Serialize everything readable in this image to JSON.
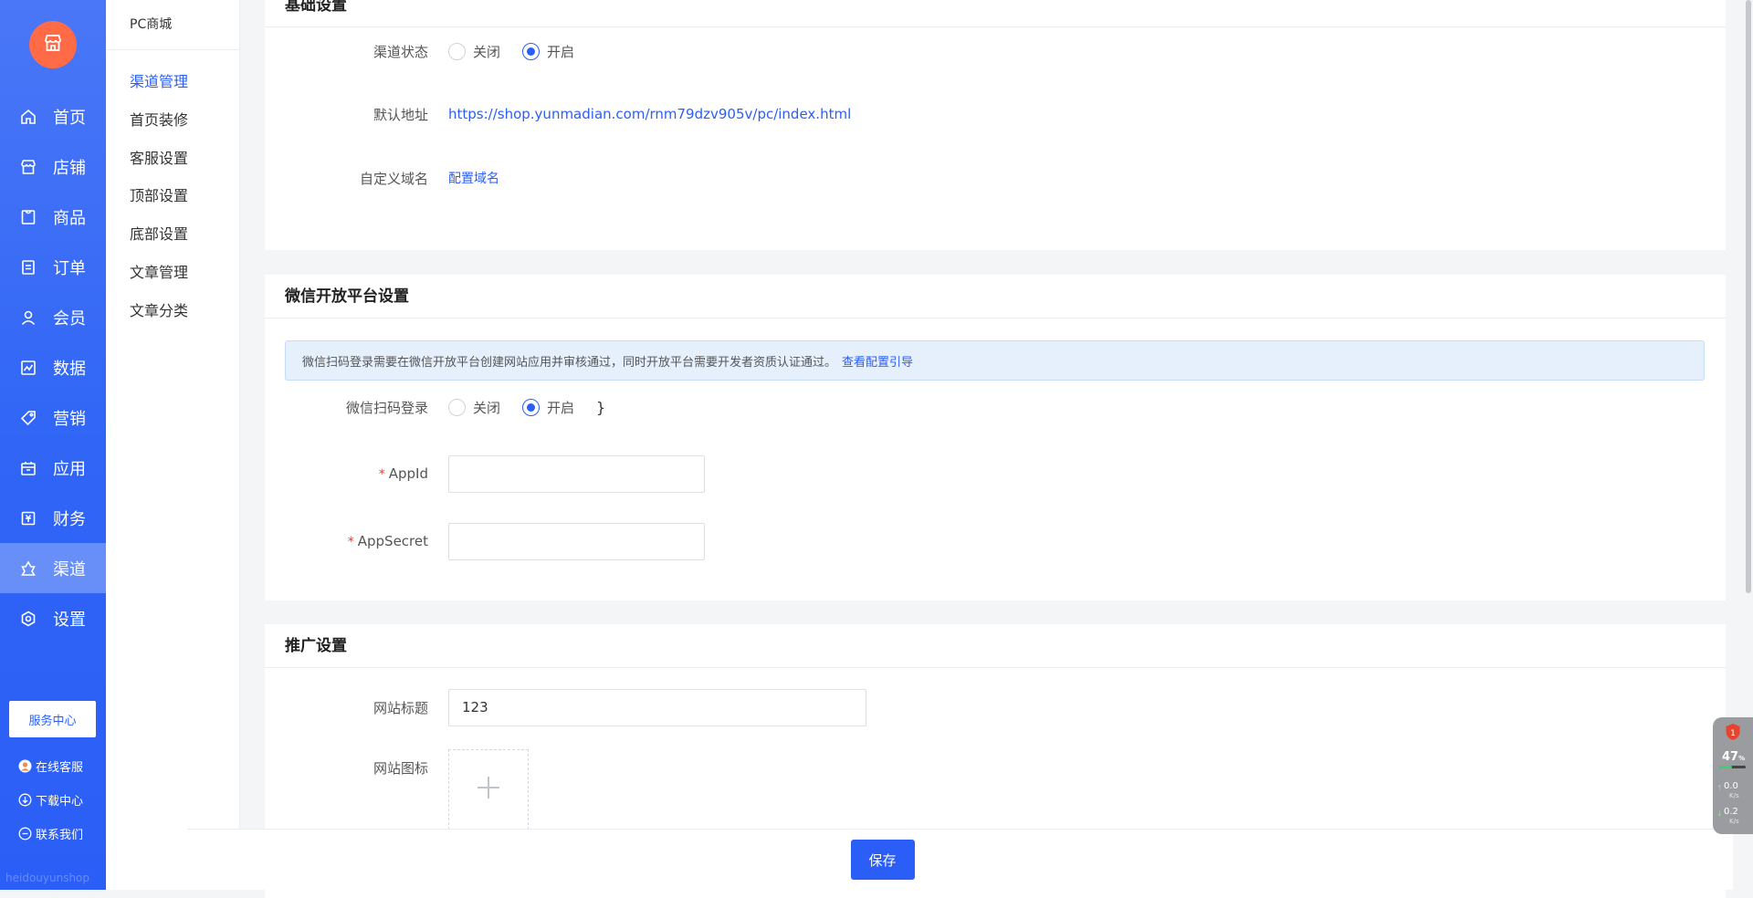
{
  "sidebar": {
    "logo_icon": "shop-icon",
    "items": [
      {
        "label": "首页",
        "icon": "home-icon"
      },
      {
        "label": "店铺",
        "icon": "store-icon"
      },
      {
        "label": "商品",
        "icon": "goods-icon"
      },
      {
        "label": "订单",
        "icon": "order-icon"
      },
      {
        "label": "会员",
        "icon": "member-icon"
      },
      {
        "label": "数据",
        "icon": "chart-icon"
      },
      {
        "label": "营销",
        "icon": "tag-icon"
      },
      {
        "label": "应用",
        "icon": "app-box-icon"
      },
      {
        "label": "财务",
        "icon": "finance-icon"
      },
      {
        "label": "渠道",
        "icon": "channel-icon",
        "active": true
      },
      {
        "label": "设置",
        "icon": "gear-icon"
      }
    ],
    "service_center": "服务中心",
    "links": [
      {
        "label": "在线客服",
        "icon": "avatar-icon"
      },
      {
        "label": "下载中心",
        "icon": "download-icon"
      },
      {
        "label": "联系我们",
        "icon": "chat-icon"
      }
    ],
    "watermark": "heidouyunshop"
  },
  "subnav": {
    "title": "PC商城",
    "items": [
      "渠道管理",
      "首页装修",
      "客服设置",
      "顶部设置",
      "底部设置",
      "文章管理",
      "文章分类"
    ],
    "active_index": 0
  },
  "basic": {
    "title": "基础设置",
    "channel_status_label": "渠道状态",
    "radio_off": "关闭",
    "radio_on": "开启",
    "channel_status_value": "on",
    "default_address_label": "默认地址",
    "default_address": "https://shop.yunmadian.com/rnm79dzv905v/pc/index.html",
    "custom_domain_label": "自定义域名",
    "custom_domain_link": "配置域名"
  },
  "wechat": {
    "title": "微信开放平台设置",
    "notice": "微信扫码登录需要在微信开放平台创建网站应用并审核通过，同时开放平台需要开发者资质认证通过。",
    "notice_link": "查看配置引导",
    "scan_login_label": "微信扫码登录",
    "radio_off": "关闭",
    "radio_on": "开启",
    "scan_login_value": "on",
    "appid_label": "AppId",
    "appid_value": "",
    "appsecret_label": "AppSecret",
    "appsecret_value": "",
    "required_mark": "*"
  },
  "promo": {
    "title": "推广设置",
    "site_title_label": "网站标题",
    "site_title_value": "123",
    "site_icon_label": "网站图标",
    "upload_icon": "plus-icon"
  },
  "footer": {
    "save_label": "保存"
  },
  "widget": {
    "badge_count": "1",
    "cpu_percent": "47",
    "cpu_unit": "%",
    "cpu_fraction": 0.47,
    "upload_speed": "0.0",
    "download_speed": "0.2",
    "speed_unit": "K/s"
  },
  "colors": {
    "primary": "#2b5ef6",
    "logo": "#ff6b47",
    "required": "#ee3a3a",
    "notice_bg": "#e6f0fd"
  }
}
